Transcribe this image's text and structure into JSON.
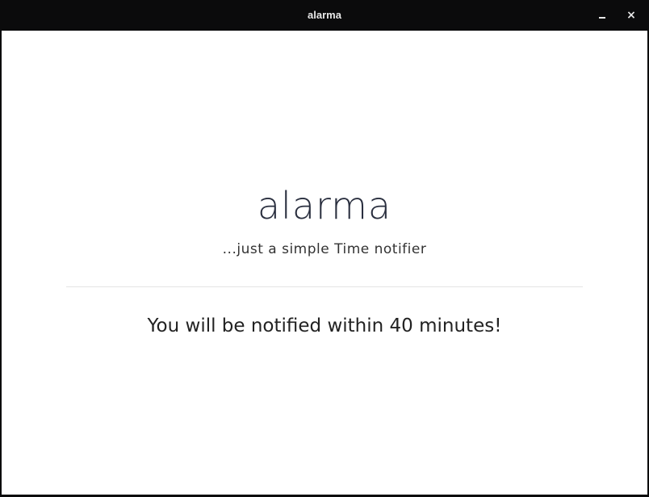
{
  "window": {
    "title": "alarma",
    "minimize_icon": "minimize-icon",
    "close_label": "×"
  },
  "main": {
    "app_title": "alarma",
    "subtitle": "...just a simple Time notifier",
    "message": "You will be notified within 40 minutes!"
  }
}
